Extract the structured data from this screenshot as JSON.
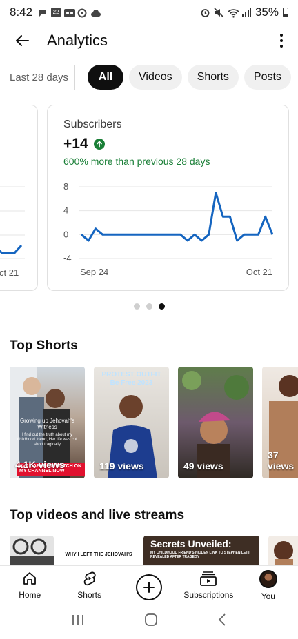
{
  "status_bar": {
    "time": "8:42",
    "battery_percent": "35%",
    "notification_badge": "22"
  },
  "app_bar": {
    "title": "Analytics"
  },
  "filters": {
    "range_label": "Last 28 days",
    "chips": [
      "All",
      "Videos",
      "Shorts",
      "Posts"
    ],
    "selected": "All"
  },
  "left_card": {
    "tick_label": "ct 21"
  },
  "subscribers_card": {
    "label": "Subscribers",
    "value": "+14",
    "delta_text": "600% more than previous 28 days",
    "accent_color": "#1a7f37"
  },
  "chart_data": {
    "type": "line",
    "title": "",
    "xlabel": "",
    "ylabel": "",
    "x_tick_labels": [
      "Sep 24",
      "Oct 21"
    ],
    "y_ticks": [
      8,
      4,
      0,
      -4
    ],
    "ylim": [
      -4,
      8
    ],
    "grid": true,
    "line_color": "#1565c0",
    "series": [
      {
        "values": [
          0,
          -1,
          1,
          0,
          0,
          0,
          0,
          0,
          0,
          0,
          0,
          0,
          0,
          0,
          0,
          -1,
          0,
          -1,
          0,
          7,
          3,
          3,
          -1,
          0,
          0,
          0,
          3,
          0
        ]
      }
    ]
  },
  "pager": {
    "count": 3,
    "active_index": 2
  },
  "top_shorts": {
    "title": "Top Shorts",
    "items": [
      {
        "views": "4.1K views",
        "overlay_text": "Growing up Jehovah's Witness",
        "overlay_sub": "I find out the truth about my childhood friend, Her life was cut short tragically",
        "banner": "AVAILABLE TO WATCH ON MY CHANNEL NOW"
      },
      {
        "views": "119 views",
        "overlay_text": "PROTEST OUTFIT Be Free 2023"
      },
      {
        "views": "49 views"
      },
      {
        "views": "37 views"
      }
    ]
  },
  "top_videos": {
    "title": "Top videos and live streams",
    "items": [
      {
        "text": ""
      },
      {
        "text": "WHY I LEFT THE JEHOVAH'S"
      },
      {
        "text": "Secrets Unveiled:",
        "sub": "MY CHILDHOOD FRIEND'S HIDDEN LINK TO STEPHEN LETT REVEALED AFTER TRAGEDY"
      },
      {
        "text": ""
      }
    ]
  },
  "bottom_nav": {
    "items": [
      {
        "label": "Home",
        "icon": "home-icon"
      },
      {
        "label": "Shorts",
        "icon": "shorts-icon"
      },
      {
        "label": "",
        "icon": "create-icon"
      },
      {
        "label": "Subscriptions",
        "icon": "subscriptions-icon"
      },
      {
        "label": "You",
        "icon": "avatar"
      }
    ]
  }
}
